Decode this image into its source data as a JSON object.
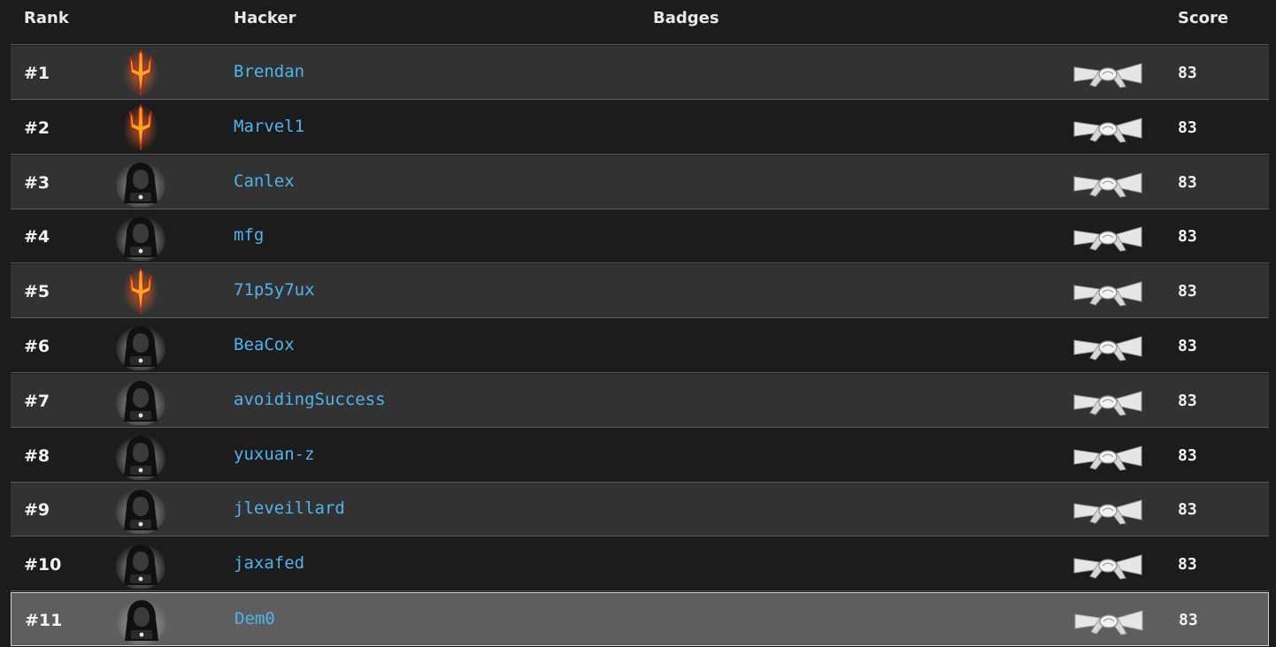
{
  "header": {
    "rank": "Rank",
    "hacker": "Hacker",
    "badges": "Badges",
    "score": "Score"
  },
  "rows": [
    {
      "rank": "#1",
      "name": "Brendan",
      "avatar": "pitchfork-icon",
      "belt": "white-belt-icon",
      "score": "83"
    },
    {
      "rank": "#2",
      "name": "Marvel1",
      "avatar": "pitchfork-icon",
      "belt": "white-belt-icon",
      "score": "83"
    },
    {
      "rank": "#3",
      "name": "Canlex",
      "avatar": "hooded-hacker-icon",
      "belt": "white-belt-icon",
      "score": "83"
    },
    {
      "rank": "#4",
      "name": "mfg",
      "avatar": "hooded-hacker-icon",
      "belt": "white-belt-icon",
      "score": "83"
    },
    {
      "rank": "#5",
      "name": "71p5y7ux",
      "avatar": "pitchfork-icon",
      "belt": "white-belt-icon",
      "score": "83"
    },
    {
      "rank": "#6",
      "name": "BeaCox",
      "avatar": "hooded-hacker-icon",
      "belt": "white-belt-icon",
      "score": "83"
    },
    {
      "rank": "#7",
      "name": "avoidingSuccess",
      "avatar": "hooded-hacker-icon",
      "belt": "white-belt-icon",
      "score": "83"
    },
    {
      "rank": "#8",
      "name": "yuxuan-z",
      "avatar": "hooded-hacker-icon",
      "belt": "white-belt-icon",
      "score": "83"
    },
    {
      "rank": "#9",
      "name": "jleveillard",
      "avatar": "hooded-hacker-icon",
      "belt": "white-belt-icon",
      "score": "83"
    },
    {
      "rank": "#10",
      "name": "jaxafed",
      "avatar": "hooded-hacker-icon",
      "belt": "white-belt-icon",
      "score": "83"
    },
    {
      "rank": "#11",
      "name": "Dem0",
      "avatar": "hooded-hacker-icon",
      "belt": "white-belt-icon",
      "score": "83",
      "highlighted": true
    }
  ],
  "colors": {
    "background": "#1c1c1c",
    "row_alt": "#323232",
    "row_highlight": "#5e5e5e",
    "name_link": "#4fb4ee",
    "pitchfork": "#f5a623",
    "pitchfork_glow": "#c0392b"
  }
}
